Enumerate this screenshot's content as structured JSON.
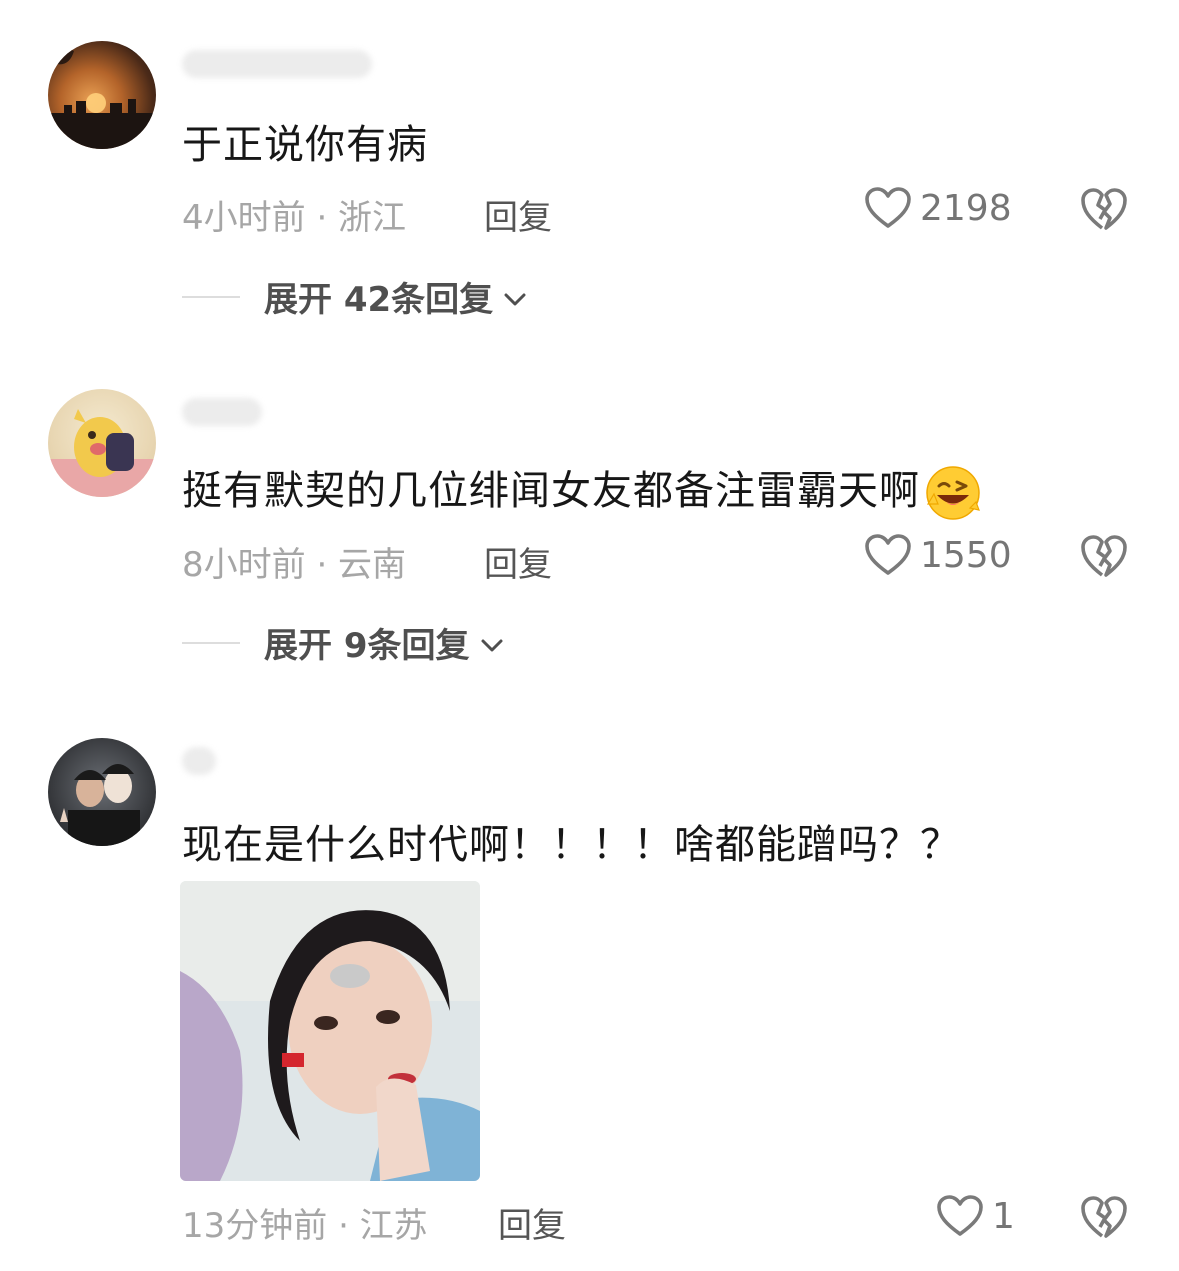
{
  "comments": [
    {
      "text": "于正说你有病",
      "meta": "4小时前 · 浙江",
      "reply": "回复",
      "likes": "2198",
      "expand": "展开 42条回复"
    },
    {
      "text": "挺有默契的几位绯闻女友都备注雷霸天啊",
      "emoji": "winking-laughing-emoji",
      "meta": "8小时前 · 云南",
      "reply": "回复",
      "likes": "1550",
      "expand": "展开 9条回复"
    },
    {
      "text": "现在是什么时代啊！！！！啥都能蹭吗？？",
      "image": "portrait-photo",
      "meta": "13分钟前 · 江苏",
      "reply": "回复",
      "likes": "1"
    }
  ],
  "icons": {
    "like": "heart-outline-icon",
    "dislike": "broken-heart-icon",
    "expand": "chevron-down-icon"
  },
  "colors": {
    "text": "#171717",
    "meta": "#a6a6a6",
    "action": "#555555"
  }
}
